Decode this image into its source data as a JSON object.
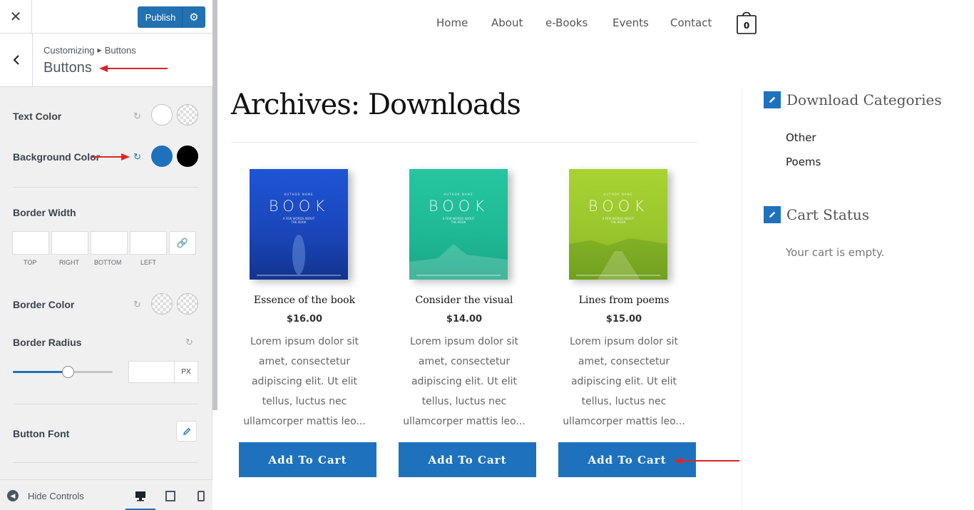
{
  "customizer": {
    "close_icon": "close-icon",
    "publish_label": "Publish",
    "publish_gear_icon": "gear-icon",
    "breadcrumb_root": "Customizing",
    "breadcrumb_current": "Buttons",
    "section_title": "Buttons",
    "controls": {
      "text_color_label": "Text Color",
      "text_color_swatches": [
        "#ffffff",
        "transparent"
      ],
      "background_color_label": "Background Color",
      "background_color_swatches": [
        "#1e72bd",
        "#000000"
      ],
      "border_width_label": "Border Width",
      "border_width_sides": [
        "TOP",
        "RIGHT",
        "BOTTOM",
        "LEFT"
      ],
      "border_color_label": "Border Color",
      "border_radius_label": "Border Radius",
      "border_radius_slider_fraction": 0.55,
      "border_radius_unit": "PX",
      "button_font_label": "Button Font"
    },
    "footer": {
      "hide_controls_label": "Hide Controls",
      "devices": [
        "desktop",
        "tablet",
        "mobile"
      ]
    }
  },
  "site": {
    "nav": [
      "Home",
      "About",
      "e-Books",
      "Events",
      "Contact"
    ],
    "cart_count": "0",
    "page_title": "Archives: Downloads",
    "products": [
      {
        "cover_author": "AUTHOR NAME",
        "cover_word": "BOOK",
        "cover_sub": [
          "A FEW WORDS ABOUT",
          "THE BOOK"
        ],
        "cover_color": "#1d4fc4",
        "title": "Essence of the book",
        "price": "$16.00",
        "desc": [
          "Lorem ipsum dolor sit",
          "amet, consectetur",
          "adipiscing elit. Ut elit",
          "tellus, luctus nec",
          "ullamcorper mattis leo..."
        ],
        "button": "Add To Cart"
      },
      {
        "cover_author": "AUTHOR NAME",
        "cover_word": "BOOK",
        "cover_sub": [
          "A FEW WORDS ABOUT",
          "THE BOOK"
        ],
        "cover_color": "#22c199",
        "title": "Consider the visual",
        "price": "$14.00",
        "desc": [
          "Lorem ipsum dolor sit",
          "amet, consectetur",
          "adipiscing elit. Ut elit",
          "tellus, luctus nec",
          "ullamcorper mattis leo..."
        ],
        "button": "Add To Cart"
      },
      {
        "cover_author": "AUTHOR NAME",
        "cover_word": "BOOK",
        "cover_sub": [
          "A FEW WORDS ABOUT",
          "THE BOOK"
        ],
        "cover_color": "#9fcc2e",
        "title": "Lines from poems",
        "price": "$15.00",
        "desc": [
          "Lorem ipsum dolor sit",
          "amet, consectetur",
          "adipiscing elit. Ut elit",
          "tellus, luctus nec",
          "ullamcorper mattis leo..."
        ],
        "button": "Add To Cart"
      }
    ],
    "sidebar": {
      "categories_title": "Download Categories",
      "categories": [
        "Other",
        "Poems"
      ],
      "cart_title": "Cart Status",
      "cart_empty": "Your cart is empty."
    }
  },
  "colors": {
    "accent": "#1e72bd",
    "wp_blue": "#2271b1",
    "annotation_red": "#e02424"
  }
}
